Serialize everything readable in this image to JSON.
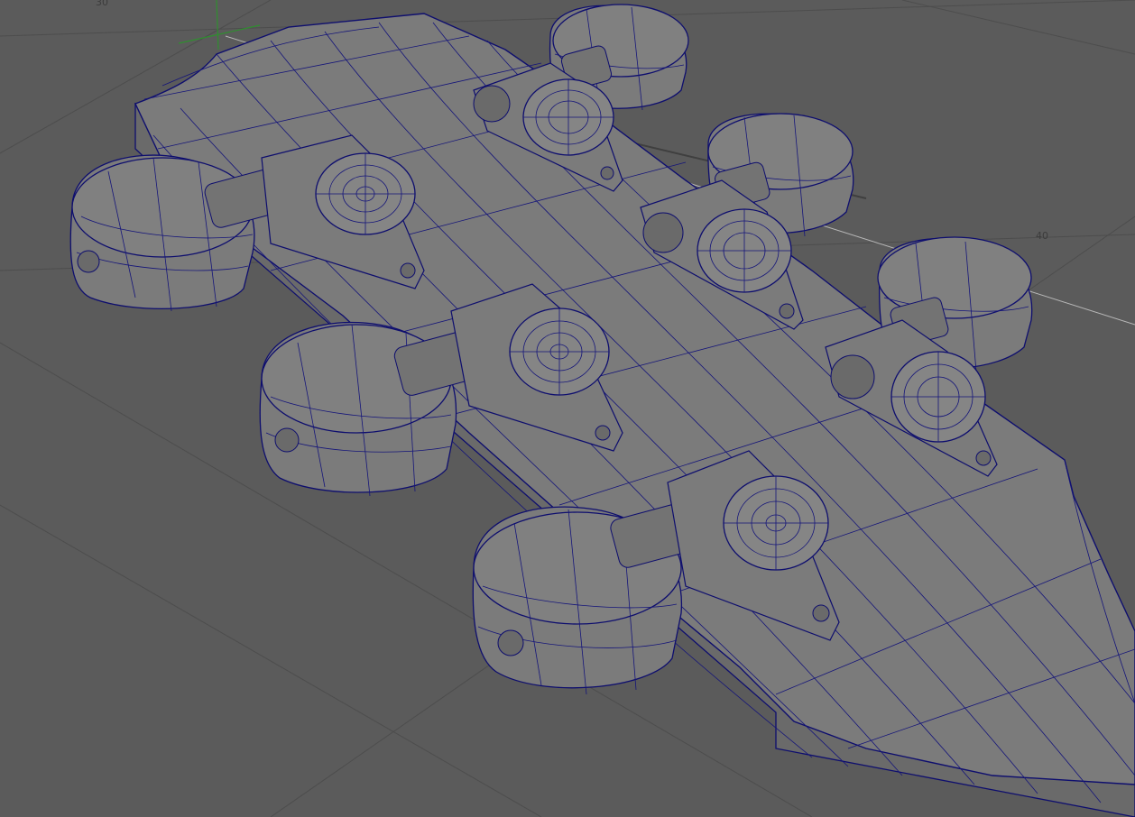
{
  "viewport": {
    "background_color": "#5b5b5b",
    "mesh_fill_color": "#7b7b7b",
    "wireframe_color": "#15157a",
    "grid_line_color": "#4d4d4d",
    "axis_z_color": "#2f8f2f",
    "axis_x_color": "#b8b8b8",
    "grid_label_x": "40",
    "grid_label_corner": "30"
  },
  "scene": {
    "headstock_icon": "guitar-headstock-mesh",
    "tuner_icon": "tuner-peg-mesh",
    "tuner_count": 6
  }
}
